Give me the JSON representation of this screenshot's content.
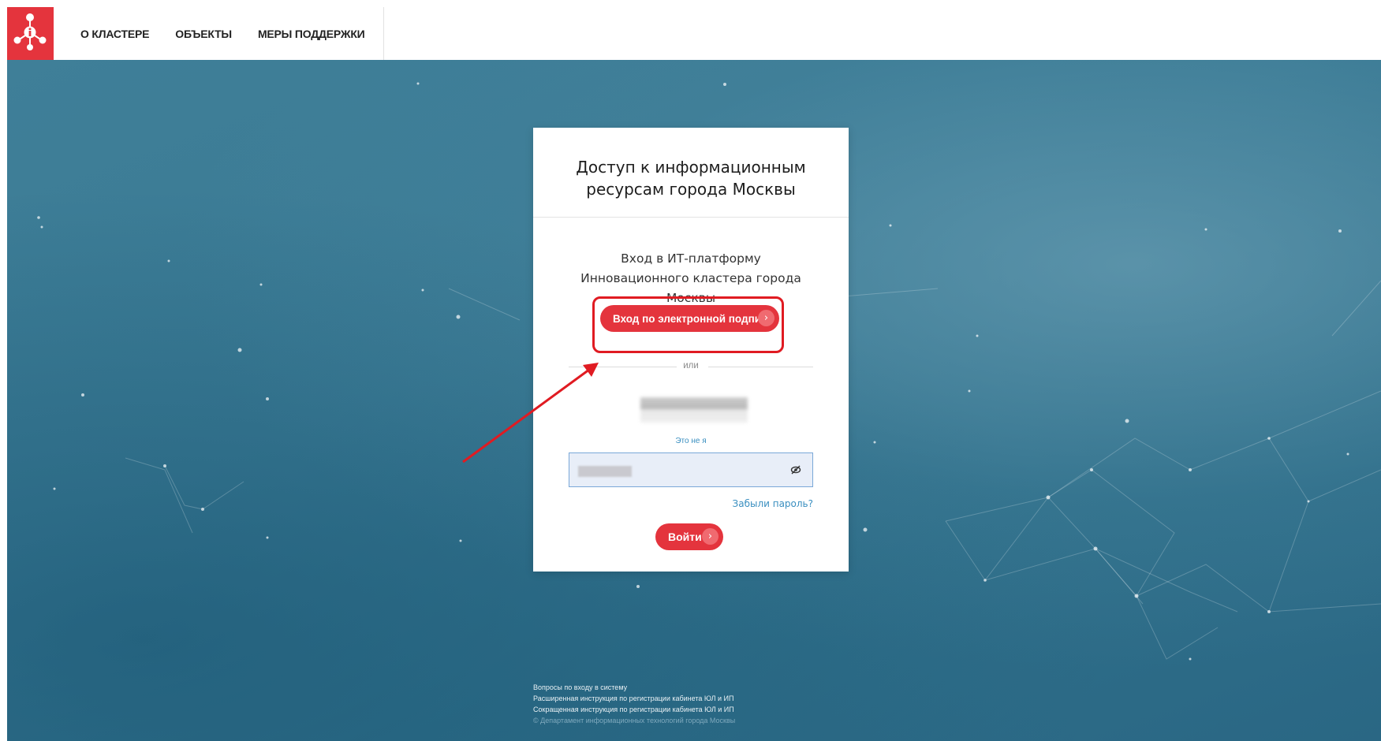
{
  "header": {
    "nav": [
      {
        "label": "О КЛАСТЕРЕ"
      },
      {
        "label": "ОБЪЕКТЫ"
      },
      {
        "label": "МЕРЫ ПОДДЕРЖКИ"
      }
    ],
    "logo_icon": "network-info-icon",
    "brand_color": "#e4343d"
  },
  "login": {
    "title": "Доступ к информационным ресурсам города Москвы",
    "subtitle": "Вход в ИТ-платформу Инновационного кластера города Москвы",
    "signature_button": "Вход по электронной подписи",
    "or_text": "или",
    "not_me_link": "Это не я",
    "password_icon": "eye-slash-icon",
    "forgot_link": "Забыли пароль?",
    "login_button": "Войти"
  },
  "footer": {
    "links": [
      "Вопросы по входу в систему",
      "Расширенная инструкция по регистрации кабинета ЮЛ и ИП",
      "Сокращенная инструкция по регистрации кабинета ЮЛ и ИП"
    ],
    "copyright": "© Департамент информационных технологий города Москвы"
  },
  "colors": {
    "accent": "#e4343d",
    "highlight": "#e01b22",
    "link": "#3a8fc0"
  }
}
